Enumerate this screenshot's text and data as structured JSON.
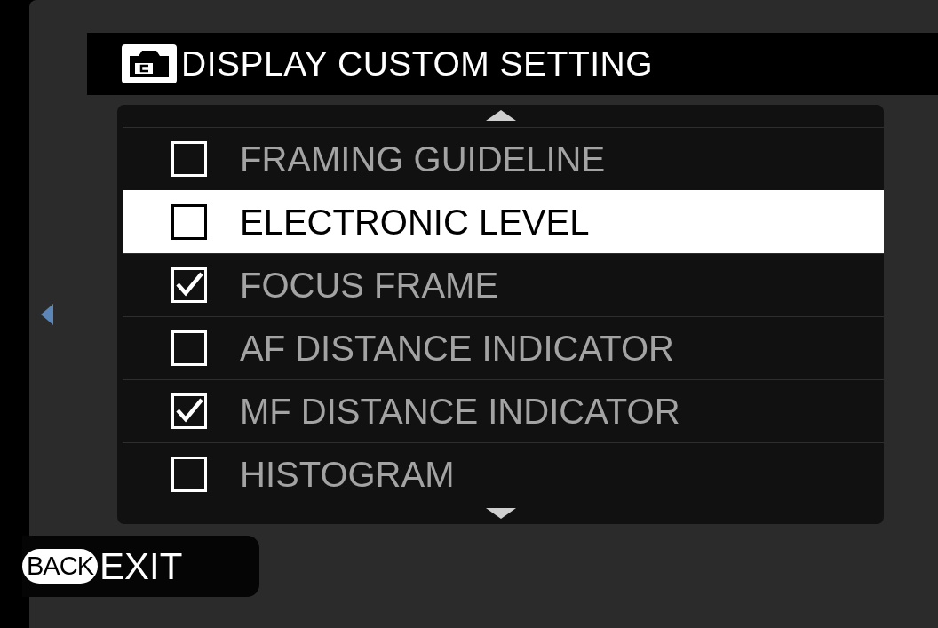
{
  "title": "DISPLAY CUSTOM SETTING",
  "items": [
    {
      "label": "FRAMING GUIDELINE",
      "checked": false,
      "selected": false
    },
    {
      "label": "ELECTRONIC LEVEL",
      "checked": false,
      "selected": true
    },
    {
      "label": "FOCUS FRAME",
      "checked": true,
      "selected": false
    },
    {
      "label": "AF DISTANCE INDICATOR",
      "checked": false,
      "selected": false
    },
    {
      "label": "MF DISTANCE INDICATOR",
      "checked": true,
      "selected": false
    },
    {
      "label": "HISTOGRAM",
      "checked": false,
      "selected": false
    }
  ],
  "footer": {
    "key": "BACK",
    "label": "EXIT"
  }
}
